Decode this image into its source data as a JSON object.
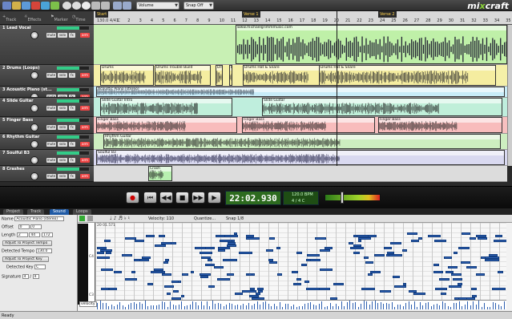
{
  "app": {
    "logo_main": "mi",
    "logo_accent": "x",
    "logo_rest": "craft"
  },
  "toolbar": {
    "snap_select": "Volume",
    "snap_mode": "Snap Off"
  },
  "track_toolbar": {
    "add_track": "Track",
    "effects": "Effects",
    "marker": "Marker",
    "time": "Time"
  },
  "ruler": {
    "markers": [
      "Start",
      "Verse 1",
      "Verse 2"
    ],
    "tempo": "130.0 4/4 C",
    "ticks": [
      "1",
      "2",
      "3",
      "4",
      "5",
      "6",
      "7",
      "8",
      "9",
      "10",
      "11",
      "12",
      "13",
      "14",
      "15",
      "16",
      "17",
      "18",
      "19",
      "20",
      "21",
      "22",
      "23",
      "24",
      "25",
      "26",
      "27",
      "28",
      "29",
      "30",
      "31",
      "32",
      "33",
      "34",
      "35",
      "36"
    ]
  },
  "track_buttons": {
    "mute": "mute",
    "solo": "solo",
    "fx": "fx",
    "arm": "arm"
  },
  "tracks": [
    {
      "name": "1 Lead Vocal",
      "color": "#c8f0b4",
      "clips": [
        {
          "label": "www.michaelgrimmmusic.com",
          "color": "#bff0a8"
        }
      ]
    },
    {
      "name": "2 Drums (Loops)",
      "color": "#f5f0a8",
      "clips": [
        {
          "label": "Drums",
          "color": "#f5eda0"
        },
        {
          "label": "Drums Trouble Build",
          "color": "#f5eda0"
        },
        {
          "label": "Drums Ride & Snare",
          "color": "#f5eda0"
        },
        {
          "label": "Drums",
          "color": "#f5eda0"
        },
        {
          "label": "Drums Hat & Snare",
          "color": "#f5eda0"
        },
        {
          "label": "Drums Hat & Snare",
          "color": "#f5eda0"
        }
      ]
    },
    {
      "name": "3 Acoustic Piano (st...",
      "color": "#c8ecf8",
      "clips": [
        {
          "label": "Acoustic Piano (stereo)",
          "color": "#c8ecf8"
        }
      ]
    },
    {
      "name": "4 Slide Guitar",
      "color": "#bfeedd",
      "clips": [
        {
          "label": "Slide Guitar Intro",
          "color": "#c0efd9"
        },
        {
          "label": "Slide Guitar",
          "color": "#c0efd9"
        }
      ]
    },
    {
      "name": "5 Finger Bass",
      "color": "#f8c0c0",
      "clips": [
        {
          "label": "Finger Bass",
          "color": "#f8bcbc"
        },
        {
          "label": "Finger Bass",
          "color": "#f8bcbc"
        },
        {
          "label": "Finger Bass",
          "color": "#f8bcbc"
        }
      ]
    },
    {
      "name": "6 Rhythm Guitar",
      "color": "#cdeec0",
      "clips": [
        {
          "label": "Rhythm Guitar",
          "color": "#cdeec0"
        }
      ]
    },
    {
      "name": "7 Soulful B3",
      "color": "#d8d8f0",
      "clips": [
        {
          "label": "Soulful B3",
          "color": "#d9d9f0"
        }
      ]
    },
    {
      "name": "8 Crashes",
      "color": "#dcdcdc",
      "clips": [
        {
          "label": "Crash",
          "color": "#b8f0b0"
        }
      ]
    }
  ],
  "transport": {
    "time": "22:02.930",
    "bpm": "120.0 BPM",
    "signature": "4 / 4  C"
  },
  "bottom_tabs": [
    "Project",
    "Track",
    "Sound",
    "Loops"
  ],
  "props": {
    "name_label": "Name",
    "name_value": "Acoustic Piano (stereo)",
    "offset_label": "Offset",
    "offset_a": "0",
    "offset_b": "0",
    "length_label": "Length",
    "length_a": "2",
    "length_b": "44",
    "length_c": "172",
    "adjust_tempo": "Adjust To Project Tempo",
    "detected_tempo_label": "Detected Tempo",
    "detected_tempo": "130.0",
    "adjust_key": "Adjust To Project Key",
    "detected_key_label": "Detected Key",
    "detected_key": "C",
    "signature_label": "Signature",
    "sig_a": "4",
    "sig_b": "4"
  },
  "piano_roll": {
    "velocity_label": "Velocity: 110",
    "quantize": "Quantize...",
    "snap": "Snap 1/8",
    "position": "20 01.571",
    "c_label": "C4",
    "c3": "C3",
    "velocity_lane": "velocity"
  },
  "status": "Ready"
}
